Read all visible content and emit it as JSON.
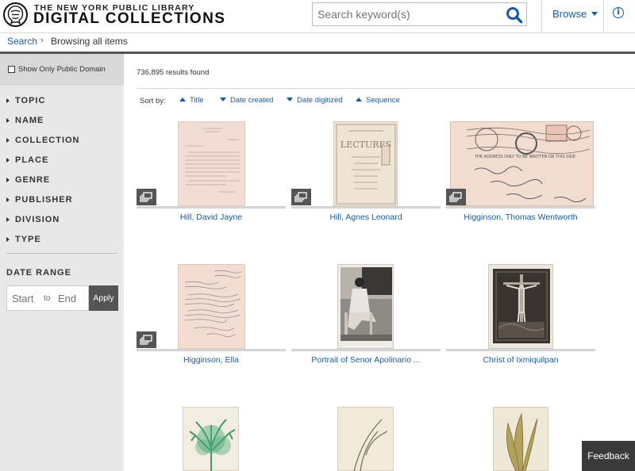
{
  "header": {
    "logo_line1": "THE NEW YORK PUBLIC LIBRARY",
    "logo_line2": "DIGITAL COLLECTIONS",
    "search_placeholder": "Search keyword(s)",
    "search_icon": "search-icon",
    "browse_label": "Browse",
    "info_label": "i"
  },
  "breadcrumb": {
    "search": "Search",
    "separator": "›",
    "current": "Browsing all items"
  },
  "sidebar": {
    "public_domain_label": "Show Only Public Domain",
    "facets": [
      "TOPIC",
      "NAME",
      "COLLECTION",
      "PLACE",
      "GENRE",
      "PUBLISHER",
      "DIVISION",
      "TYPE"
    ],
    "date_range": {
      "title": "DATE RANGE",
      "start_placeholder": "Start",
      "to_label": "to",
      "end_placeholder": "End",
      "apply_label": "Apply"
    }
  },
  "main": {
    "results_count": "736,895 results found",
    "sort_by_label": "Sort by:",
    "sort_options": [
      {
        "label": "Title",
        "direction": "up"
      },
      {
        "label": "Date created",
        "direction": "down"
      },
      {
        "label": "Date digitized",
        "direction": "down"
      },
      {
        "label": "Sequence",
        "direction": "up"
      }
    ],
    "items": [
      {
        "title": "Hill, David Jayne",
        "multi": true
      },
      {
        "title": "Hill, Agnes Leonard",
        "multi": true
      },
      {
        "title": "Higginson, Thomas Wentworth",
        "multi": true
      },
      {
        "title": "Higginson, Ella",
        "multi": true
      },
      {
        "title": "Portrait of Senor Apolinario ...",
        "multi": false
      },
      {
        "title": "Christ of Ixmiquilpan",
        "multi": false
      },
      {
        "title": "",
        "multi": false
      },
      {
        "title": "",
        "multi": false
      },
      {
        "title": "",
        "multi": false
      }
    ]
  },
  "feedback_label": "Feedback",
  "colors": {
    "link": "#1a5a9a",
    "sidebar_bg": "#e8e8e8",
    "dark": "#555555"
  }
}
